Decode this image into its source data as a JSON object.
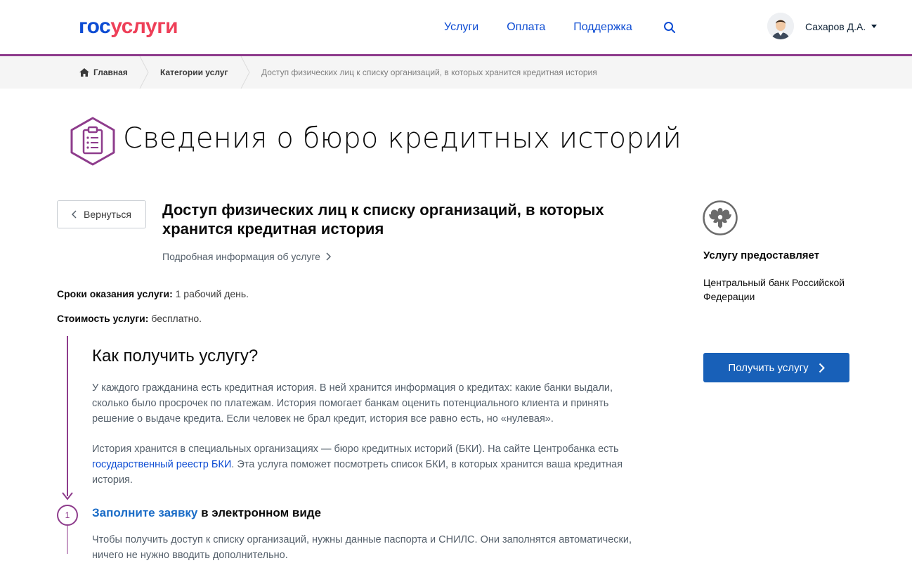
{
  "header": {
    "logo_part1": "гос",
    "logo_part2": "услуги",
    "nav": [
      "Услуги",
      "Оплата",
      "Поддержка"
    ],
    "user_name": "Сахаров Д.А."
  },
  "breadcrumb": {
    "home": "Главная",
    "categories": "Категории услуг",
    "current": "Доступ физических лиц к списку организаций, в которых хранится кредитная история"
  },
  "page": {
    "title": "Сведения о бюро кредитных историй",
    "back_label": "Вернуться",
    "service_title": "Доступ физических лиц к списку организаций, в которых хранится кредитная история",
    "more_info": "Подробная информация об услуге",
    "terms_label": "Сроки оказания услуги:",
    "terms_value": "1 рабочий день.",
    "cost_label": "Стоимость услуги:",
    "cost_value": "бесплатно.",
    "how_title": "Как получить услугу?",
    "para1": "У каждого гражданина есть кредитная история. В ней хранится информация о кредитах: какие банки выдали, сколько было просрочек по платежам. История помогает банкам оценить потенциального клиента и принять решение о выдаче кредита. Если человек не брал кредит, история все равно есть, но «нулевая».",
    "para2_before": "История хранится в специальных организациях — бюро кредитных историй (БКИ). На сайте Центробанка есть ",
    "para2_link": "государственный реестр БКИ",
    "para2_after": ". Эта услуга поможет посмотреть список БКИ, в которых хранится ваша кредитная история.",
    "step_number": "1",
    "step_title_link": "Заполните заявку",
    "step_title_rest": " в электронном виде",
    "para3": "Чтобы получить доступ к списку организаций, нужны данные паспорта и СНИЛС. Они заполнятся автоматически, ничего не нужно вводить дополнительно."
  },
  "sidebar": {
    "provider_label": "Услугу предоставляет",
    "provider_name": "Центральный банк Российской Федерации",
    "get_button": "Получить услугу"
  },
  "colors": {
    "accent_purple": "#8e3c8c",
    "link_blue": "#0d4cd3",
    "button_blue": "#1860b8",
    "logo_red": "#ee3f58"
  }
}
